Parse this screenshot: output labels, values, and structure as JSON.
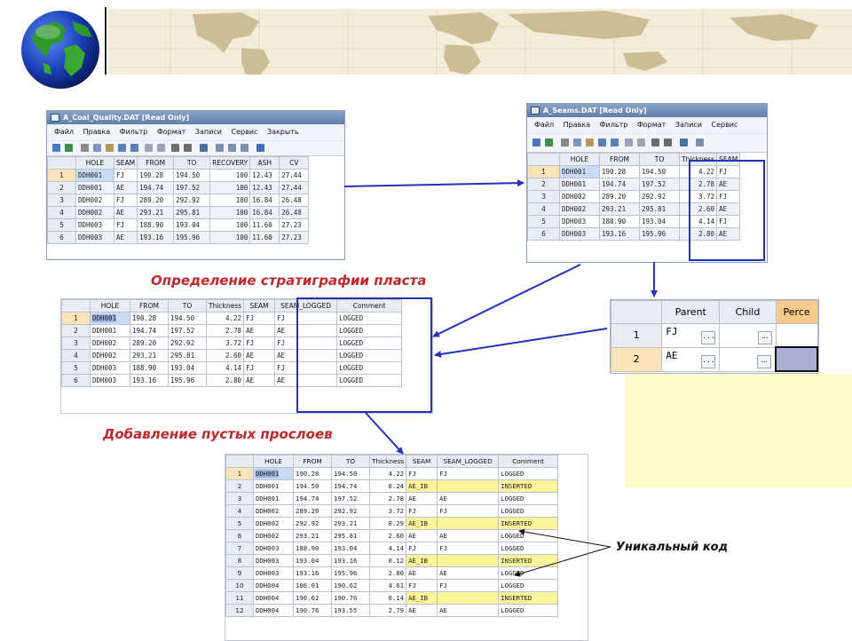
{
  "colors": {
    "accent_blue": "#2233bb",
    "caption_red": "#c0272d",
    "highlight_yellow": "#fbf59a"
  },
  "window1": {
    "title": "A_Coal_Quality.DAT [Read Only]",
    "menu": [
      "Файл",
      "Правка",
      "Фильтр",
      "Формат",
      "Записи",
      "Сервис",
      "Закрыть"
    ],
    "columns": [
      "HOLE",
      "SEAM",
      "FROM",
      "TO",
      "RECOVERY",
      "ASH",
      "CV"
    ],
    "rows": [
      [
        "1",
        "DDH001",
        "FJ",
        "190.28",
        "194.50",
        "100",
        "12.43",
        "27.44"
      ],
      [
        "2",
        "DDH001",
        "AE",
        "194.74",
        "197.52",
        "100",
        "12.43",
        "27.44"
      ],
      [
        "3",
        "DDH002",
        "FJ",
        "289.20",
        "292.92",
        "100",
        "16.84",
        "26.48"
      ],
      [
        "4",
        "DDH002",
        "AE",
        "293.21",
        "295.81",
        "100",
        "16.84",
        "26.48"
      ],
      [
        "5",
        "DDH003",
        "FJ",
        "188.90",
        "193.04",
        "100",
        "11.60",
        "27.23"
      ],
      [
        "6",
        "DDH003",
        "AE",
        "193.16",
        "195.96",
        "100",
        "11.60",
        "27.23"
      ]
    ]
  },
  "window2": {
    "title": "A_Seams.DAT [Read Only]",
    "menu": [
      "Файл",
      "Правка",
      "Фильтр",
      "Формат",
      "Записи",
      "Сервис"
    ],
    "columns": [
      "HOLE",
      "FROM",
      "TO",
      "Thickness",
      "SEAM"
    ],
    "rows": [
      [
        "1",
        "DDH001",
        "190.28",
        "194.50",
        "4.22",
        "FJ"
      ],
      [
        "2",
        "DDH001",
        "194.74",
        "197.52",
        "2.78",
        "AE"
      ],
      [
        "3",
        "DDH002",
        "289.20",
        "292.92",
        "3.72",
        "FJ"
      ],
      [
        "4",
        "DDH002",
        "293.21",
        "295.81",
        "2.60",
        "AE"
      ],
      [
        "5",
        "DDH003",
        "188.90",
        "193.04",
        "4.14",
        "FJ"
      ],
      [
        "6",
        "DDH003",
        "193.16",
        "195.96",
        "2.80",
        "AE"
      ]
    ]
  },
  "caption1": "Определение стратиграфии пласта",
  "table3": {
    "columns": [
      "HOLE",
      "FROM",
      "TO",
      "Thickness",
      "SEAM",
      "SEAM_LOGGED",
      "Comment"
    ],
    "rows": [
      [
        "1",
        "DDH001",
        "190.28",
        "194.50",
        "4.22",
        "FJ",
        "FJ",
        "LOGGED"
      ],
      [
        "2",
        "DDH001",
        "194.74",
        "197.52",
        "2.78",
        "AE",
        "AE",
        "LOGGED"
      ],
      [
        "3",
        "DDH002",
        "289.20",
        "292.92",
        "3.72",
        "FJ",
        "FJ",
        "LOGGED"
      ],
      [
        "4",
        "DDH002",
        "293.21",
        "295.81",
        "2.60",
        "AE",
        "AE",
        "LOGGED"
      ],
      [
        "5",
        "DDH003",
        "188.90",
        "193.04",
        "4.14",
        "FJ",
        "FJ",
        "LOGGED"
      ],
      [
        "6",
        "DDH003",
        "193.16",
        "195.96",
        "2.80",
        "AE",
        "AE",
        "LOGGED"
      ]
    ]
  },
  "parent_child": {
    "columns": [
      "Parent",
      "Child",
      "Perce"
    ],
    "rows": [
      [
        "1",
        "FJ",
        "...",
        "",
        "..."
      ],
      [
        "2",
        "AE",
        "...",
        "",
        "..."
      ]
    ]
  },
  "caption2": "Добавление пустых прослоев",
  "table4": {
    "columns": [
      "HOLE",
      "FROM",
      "TO",
      "Thickness",
      "SEAM",
      "SEAM_LOGGED",
      "Comment"
    ],
    "rows": [
      [
        "1",
        "DDH001",
        "190.28",
        "194.50",
        "4.22",
        "FJ",
        "FJ",
        "LOGGED"
      ],
      [
        "2",
        "DDH001",
        "194.50",
        "194.74",
        "0.24",
        "AE_IB",
        "",
        "INSERTED"
      ],
      [
        "3",
        "DDH001",
        "194.74",
        "197.52",
        "2.78",
        "AE",
        "AE",
        "LOGGED"
      ],
      [
        "4",
        "DDH002",
        "289.20",
        "292.92",
        "3.72",
        "FJ",
        "FJ",
        "LOGGED"
      ],
      [
        "5",
        "DDH002",
        "292.92",
        "293.21",
        "0.29",
        "AE_IB",
        "",
        "INSERTED"
      ],
      [
        "6",
        "DDH002",
        "293.21",
        "295.81",
        "2.60",
        "AE",
        "AE",
        "LOGGED"
      ],
      [
        "7",
        "DDH003",
        "188.90",
        "193.04",
        "4.14",
        "FJ",
        "FJ",
        "LOGGED"
      ],
      [
        "8",
        "DDH003",
        "193.04",
        "193.16",
        "0.12",
        "AE_IB",
        "",
        "INSERTED"
      ],
      [
        "9",
        "DDH003",
        "193.16",
        "195.96",
        "2.80",
        "AE",
        "AE",
        "LOGGED"
      ],
      [
        "10",
        "DDH004",
        "186.01",
        "190.62",
        "4.61",
        "FJ",
        "FJ",
        "LOGGED"
      ],
      [
        "11",
        "DDH004",
        "190.62",
        "190.76",
        "0.14",
        "AE_IB",
        "",
        "INSERTED"
      ],
      [
        "12",
        "DDH004",
        "190.76",
        "193.55",
        "2.79",
        "AE",
        "AE",
        "LOGGED"
      ]
    ]
  },
  "annotation_unique": "Уникальный код"
}
